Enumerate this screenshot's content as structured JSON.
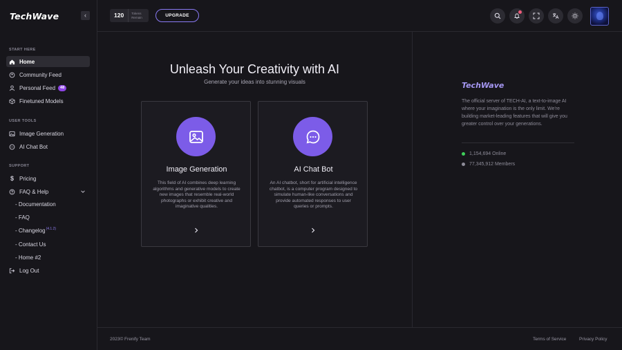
{
  "brand": "TechWave",
  "sidebar": {
    "sections": [
      {
        "label": "START HERE"
      },
      {
        "label": "USER TOOLS"
      },
      {
        "label": "SUPPORT"
      }
    ],
    "items": [
      {
        "label": "Home",
        "icon": "home-icon"
      },
      {
        "label": "Community Feed",
        "icon": "community-icon"
      },
      {
        "label": "Personal Feed",
        "icon": "user-icon",
        "badge": "48"
      },
      {
        "label": "Finetuned Models",
        "icon": "cube-icon"
      },
      {
        "label": "Image Generation",
        "icon": "image-icon"
      },
      {
        "label": "AI Chat Bot",
        "icon": "chat-icon"
      },
      {
        "label": "Pricing",
        "icon": "dollar-icon"
      },
      {
        "label": "FAQ & Help",
        "icon": "help-icon"
      },
      {
        "label": "Log Out",
        "icon": "logout-icon"
      }
    ],
    "subitems": [
      {
        "label": "- Documentation"
      },
      {
        "label": "- FAQ"
      },
      {
        "label": "- Changelog",
        "sup": "(4.1.2)"
      },
      {
        "label": "- Contact Us"
      },
      {
        "label": "- Home #2"
      }
    ]
  },
  "header": {
    "tokens_count": "120",
    "tokens_label_1": "Tokens",
    "tokens_label_2": "Remain",
    "upgrade_label": "UPGRADE"
  },
  "main": {
    "title": "Unleash Your Creativity with AI",
    "subtitle": "Generate your ideas into stunning visuals",
    "cards": [
      {
        "title": "Image Generation",
        "icon": "image-icon",
        "description": "This field of AI combines deep learning algorithms and generative models to create new images that resemble real-world photographs or exhibit creative and imaginative qualities."
      },
      {
        "title": "AI Chat Bot",
        "icon": "chat-icon",
        "description": "An AI chatbot, short for artificial intelligence chatbot, is a computer program designed to simulate human-like conversations and provide automated responses to user queries or prompts."
      }
    ]
  },
  "right_panel": {
    "brand": "TechWave",
    "description": "The official server of TECH-AI, a text-to-image AI where your imagination is the only limit. We're building market-leading features that will give you greater control over your generations.",
    "online": "1,154,694 Online",
    "members": "77,345,912 Members",
    "online_color": "#3fcf5a",
    "members_color": "#8e8c99"
  },
  "footer": {
    "copyright": "2023© Frenify Team",
    "terms": "Terms of Service",
    "privacy": "Privacy Policy"
  },
  "colors": {
    "accent": "#7c5ce8",
    "background": "#17161b"
  }
}
